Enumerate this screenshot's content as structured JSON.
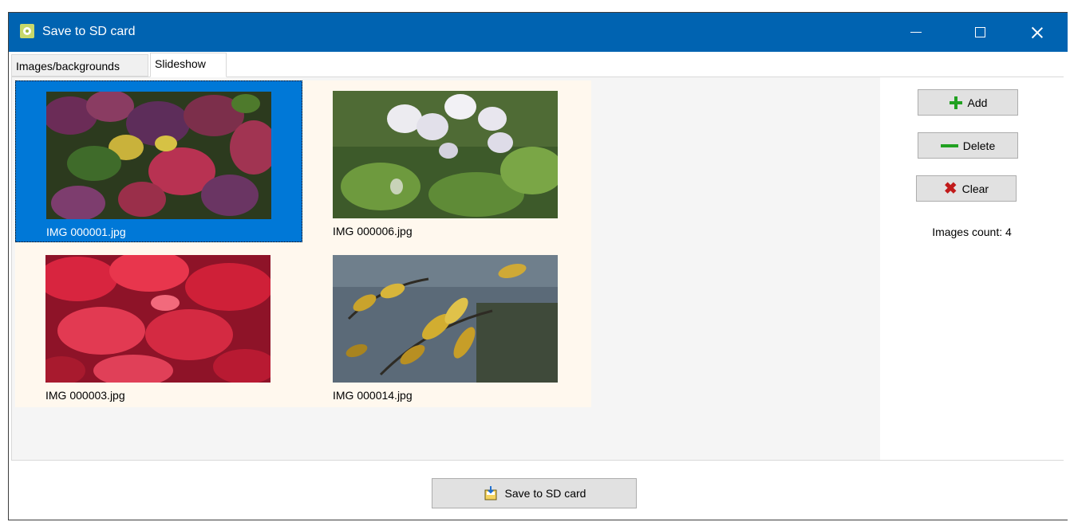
{
  "window": {
    "title": "Save to SD card",
    "icon": "flower-app-icon",
    "controls": [
      "minimize",
      "maximize",
      "close"
    ]
  },
  "tabs": [
    {
      "label": "Images/backgrounds",
      "active": false
    },
    {
      "label": "Slideshow",
      "active": true
    }
  ],
  "images": [
    {
      "name": "IMG 000001.jpg",
      "selected": true,
      "thumb": "purple-red-autumn-leaves"
    },
    {
      "name": "IMG 000006.jpg",
      "selected": false,
      "thumb": "white-flowers-green-leaves"
    },
    {
      "name": "IMG 000003.jpg",
      "selected": false,
      "thumb": "red-virginia-creeper-leaves"
    },
    {
      "name": "IMG 000014.jpg",
      "selected": false,
      "thumb": "yellow-autumn-leaves-branches"
    }
  ],
  "side_panel": {
    "add_label": "Add",
    "delete_label": "Delete",
    "clear_label": "Clear",
    "count_text": "Images count: 4"
  },
  "footer": {
    "save_label": "Save to SD card"
  },
  "colors": {
    "titlebar": "#0063b1",
    "selection": "#0078d7",
    "list_bg": "#fff8ee"
  }
}
